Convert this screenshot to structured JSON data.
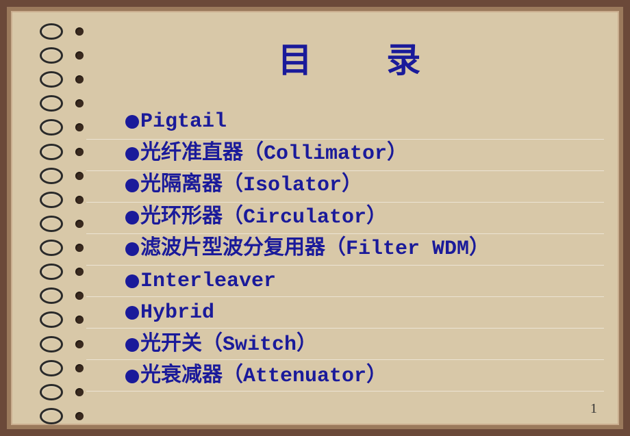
{
  "title": "目 录",
  "items": [
    "Pigtail",
    "光纤准直器（Collimator）",
    "光隔离器（Isolator）",
    "光环形器（Circulator）",
    "滤波片型波分复用器（Filter WDM）",
    "Interleaver",
    "Hybrid",
    "光开关（Switch）",
    "光衰减器（Attenuator）"
  ],
  "page_number": "1"
}
